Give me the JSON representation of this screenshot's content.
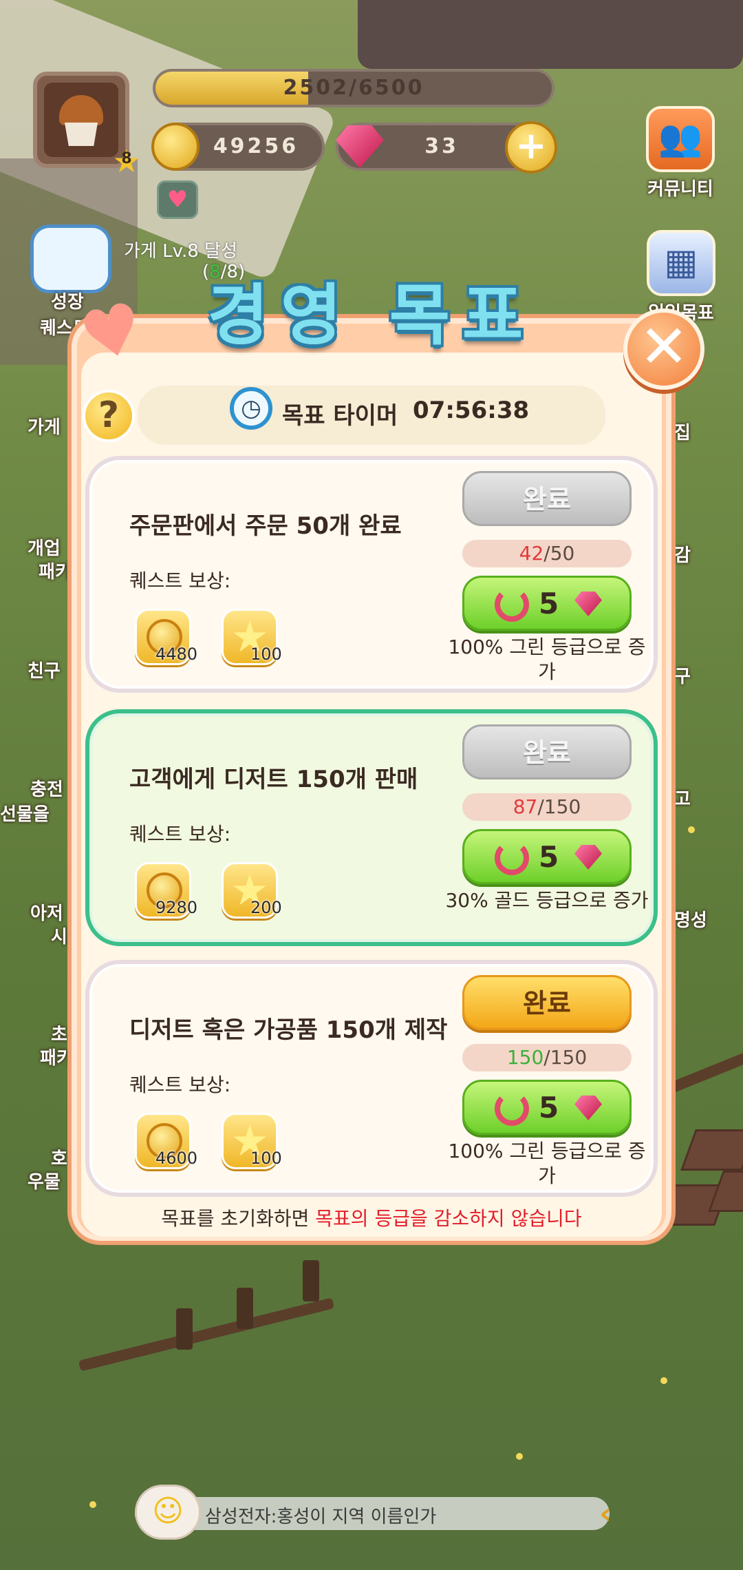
{
  "hud": {
    "xp_text": "2502/6500",
    "xp_fraction": 0.385,
    "level": "8",
    "coins": "49256",
    "gems": "33"
  },
  "side_right": [
    {
      "label": "커뮤니티",
      "icon": "people-icon"
    },
    {
      "label": "일일목표",
      "icon": "calendar-icon"
    },
    {
      "label": "집",
      "icon": "house-icon"
    },
    {
      "label": "감",
      "icon": "book-icon"
    },
    {
      "label": "구",
      "icon": "friend-icon"
    },
    {
      "label": "고",
      "icon": "shop-icon"
    },
    {
      "label": "명성",
      "icon": "fame-icon"
    }
  ],
  "side_left": [
    {
      "label": "성장"
    },
    {
      "label": "퀘스트"
    },
    {
      "label": "가게"
    },
    {
      "label": "개업"
    },
    {
      "label": "패키"
    },
    {
      "label": "친구"
    },
    {
      "label": "충전"
    },
    {
      "label": "선물을"
    },
    {
      "label": "아저"
    },
    {
      "label": "시"
    },
    {
      "label": "초"
    },
    {
      "label": "패키"
    },
    {
      "label": "호"
    },
    {
      "label": "우물"
    }
  ],
  "quest_hint": {
    "text": "가게 Lv.8 달성",
    "progress_open": "(",
    "progress_cur": "8",
    "progress_rest": "/8)"
  },
  "dialog": {
    "title": "경영 목표",
    "timer_label": "목표 타이머",
    "timer_value": "07:56:38",
    "help_label": "?",
    "close_label": "✕",
    "reward_label": "퀘스트 보상:",
    "done_label": "완료",
    "footer_prefix": "목표를 초기화하면 ",
    "footer_highlight": "목표의 등급을 감소하지 않습니다"
  },
  "quests": [
    {
      "title": "주문판에서 주문 50개 완료",
      "coin_reward": "4480",
      "star_reward": "100",
      "progress_cur": "42",
      "progress_total": "/50",
      "refresh_cost": "5",
      "bonus_text": "100% 그린 등급으로 증가",
      "status": "in-progress"
    },
    {
      "title": "고객에게 디저트 150개 판매",
      "coin_reward": "9280",
      "star_reward": "200",
      "progress_cur": "87",
      "progress_total": "/150",
      "refresh_cost": "5",
      "bonus_text": "30% 골드 등급으로 증가",
      "status": "in-progress"
    },
    {
      "title": "디저트 혹은 가공품 150개 제작",
      "coin_reward": "4600",
      "star_reward": "100",
      "progress_cur": "150",
      "progress_total": "/150",
      "refresh_cost": "5",
      "bonus_text": "100% 그린 등급으로 증가",
      "status": "complete"
    }
  ],
  "chat": {
    "message": "삼성전자:홍성이 지역 이름인가"
  },
  "colors": {
    "accent_green": "#3cbf8a",
    "done_gold": "#f3a718",
    "refresh_green": "#6ed02a",
    "warning_red": "#e21e2a"
  }
}
